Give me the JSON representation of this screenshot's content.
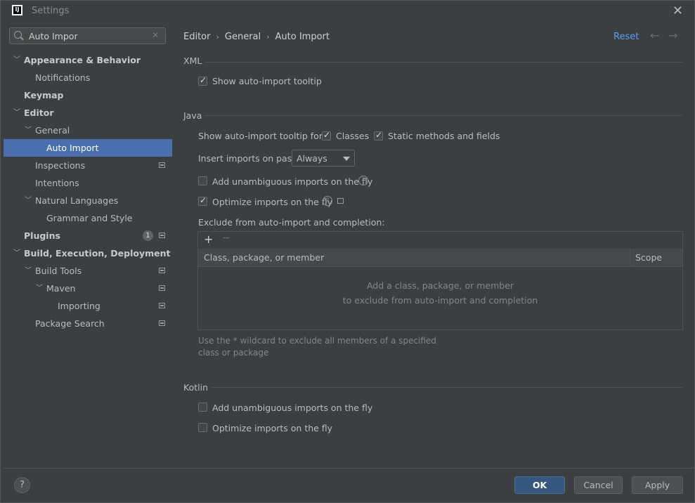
{
  "window": {
    "title": "Settings",
    "app_icon_text": "IJ"
  },
  "search": {
    "value": "Auto Impor"
  },
  "sidebar": {
    "items": [
      {
        "label": "Appearance & Behavior"
      },
      {
        "label": "Notifications"
      },
      {
        "label": "Keymap"
      },
      {
        "label": "Editor"
      },
      {
        "label": "General"
      },
      {
        "label": "Auto Import"
      },
      {
        "label": "Inspections"
      },
      {
        "label": "Intentions"
      },
      {
        "label": "Natural Languages"
      },
      {
        "label": "Grammar and Style"
      },
      {
        "label": "Plugins",
        "badge": "1"
      },
      {
        "label": "Build, Execution, Deployment"
      },
      {
        "label": "Build Tools"
      },
      {
        "label": "Maven"
      },
      {
        "label": "Importing"
      },
      {
        "label": "Package Search"
      }
    ]
  },
  "breadcrumb": {
    "items": [
      "Editor",
      "General",
      "Auto Import"
    ],
    "separator": "›"
  },
  "header": {
    "reset": "Reset",
    "back": "←",
    "forward": "→"
  },
  "xml": {
    "title": "XML",
    "show_tooltip": {
      "label": "Show auto-import tooltip",
      "checked": true
    }
  },
  "java": {
    "title": "Java",
    "tooltip_for_label": "Show auto-import tooltip for:",
    "classes": {
      "label": "Classes",
      "checked": true
    },
    "static": {
      "label": "Static methods and fields",
      "checked": true
    },
    "paste_label": "Insert imports on paste:",
    "paste_value": "Always",
    "add_unambiguous": {
      "label": "Add unambiguous imports on the fly",
      "checked": false
    },
    "optimize": {
      "label": "Optimize imports on the fly",
      "checked": true
    },
    "exclude_label": "Exclude from auto-import and completion:",
    "table": {
      "add": "+",
      "remove": "−",
      "col1": "Class, package, or member",
      "col2": "Scope",
      "empty_line1": "Add a class, package, or member",
      "empty_line2": "to exclude from auto-import and completion"
    },
    "hint": "Use the * wildcard to exclude all members of a specified class or package"
  },
  "kotlin": {
    "title": "Kotlin",
    "add_unambiguous": {
      "label": "Add unambiguous imports on the fly",
      "checked": false
    },
    "optimize": {
      "label": "Optimize imports on the fly",
      "checked": false
    }
  },
  "footer": {
    "help": "?",
    "ok": "OK",
    "cancel": "Cancel",
    "apply": "Apply"
  },
  "colors": {
    "accent": "#4b6eaf",
    "link": "#589df6",
    "ok_button": "#365880"
  },
  "icons": [
    "search-icon",
    "clear-icon",
    "chevron-down-icon",
    "chevron-right-icon",
    "settings-page-icon",
    "help-icon",
    "close-icon"
  ]
}
